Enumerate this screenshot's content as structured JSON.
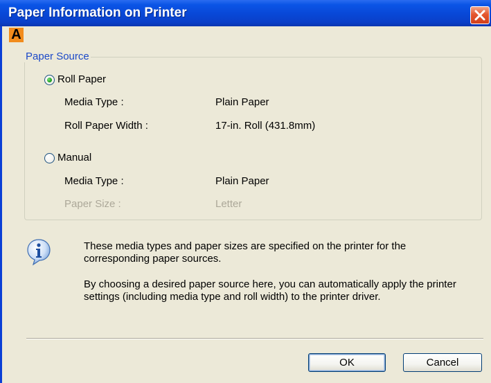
{
  "window": {
    "title": "Paper Information on Printer"
  },
  "callout": {
    "marker": "A"
  },
  "paper_source": {
    "legend": "Paper Source",
    "roll": {
      "label": "Roll Paper",
      "selected": true,
      "media_type_label": "Media Type :",
      "media_type_value": "Plain Paper",
      "width_label": "Roll Paper Width :",
      "width_value": "17-in. Roll (431.8mm)"
    },
    "manual": {
      "label": "Manual",
      "selected": false,
      "media_type_label": "Media Type :",
      "media_type_value": "Plain Paper",
      "paper_size_label": "Paper Size :",
      "paper_size_value": "Letter"
    }
  },
  "info": {
    "line1": "These media types and paper sizes are specified on the printer for the corresponding paper sources.",
    "line2": "By choosing a desired paper source here, you can automatically apply the printer settings (including media type and roll width) to the printer driver."
  },
  "buttons": {
    "ok": "OK",
    "cancel": "Cancel"
  },
  "colors": {
    "titlebar": "#0a3fd6",
    "group_legend": "#1c49c8",
    "marker": "#f28c1c",
    "disabled_text": "#aca899"
  }
}
